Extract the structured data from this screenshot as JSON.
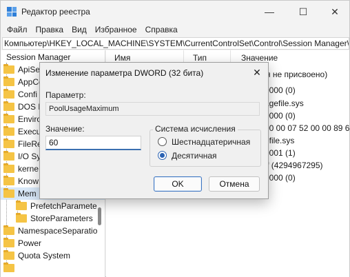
{
  "window": {
    "title": "Редактор реестра",
    "minimize_glyph": "—",
    "maximize_glyph": "☐",
    "close_glyph": "✕"
  },
  "menu": [
    "Файл",
    "Правка",
    "Вид",
    "Избранное",
    "Справка"
  ],
  "address": "Компьютер\\HKEY_LOCAL_MACHINE\\SYSTEM\\CurrentControlSet\\Control\\Session Manager\\M",
  "tree": {
    "items": [
      {
        "label": "Session Manager",
        "selected": false
      },
      {
        "label": "ApiSe"
      },
      {
        "label": "AppCo"
      },
      {
        "label": "Confi"
      },
      {
        "label": "DOS D"
      },
      {
        "label": "Enviro"
      },
      {
        "label": "Execu"
      },
      {
        "label": "FileRe"
      },
      {
        "label": "I/O Sy"
      },
      {
        "label": "kerne"
      },
      {
        "label": "Know"
      },
      {
        "label": "Mem",
        "selected": true
      },
      {
        "label": "PrefetchParamete"
      },
      {
        "label": "StoreParameters"
      },
      {
        "label": "NamespaceSeparatio"
      },
      {
        "label": "Power"
      },
      {
        "label": "Quota System"
      }
    ]
  },
  "list": {
    "headers": {
      "name": "Имя",
      "type": "Тип",
      "value": "Значение"
    },
    "values": [
      "ения не присвоено)",
      "0000 (0)",
      "agefile.sys",
      "0000 (0)",
      "00 00 07 52 00 00 89 60 00",
      "efile.sys",
      "0001 (1)",
      "ff (4294967295)",
      "0000 (0)"
    ]
  },
  "dialog": {
    "title": "Изменение параметра DWORD (32 бита)",
    "close_glyph": "✕",
    "param_label": "Параметр:",
    "param_value": "PoolUsageMaximum",
    "value_label": "Значение:",
    "value": "60",
    "base_label": "Система исчисления",
    "hex_label": "Шестнадцатеричная",
    "dec_label": "Десятичная",
    "selected_base": "dec",
    "ok_label": "OK",
    "cancel_label": "Отмена"
  },
  "colors": {
    "accent": "#2a62b3",
    "folder": "#f5c445",
    "selection": "#d8e8f8"
  }
}
